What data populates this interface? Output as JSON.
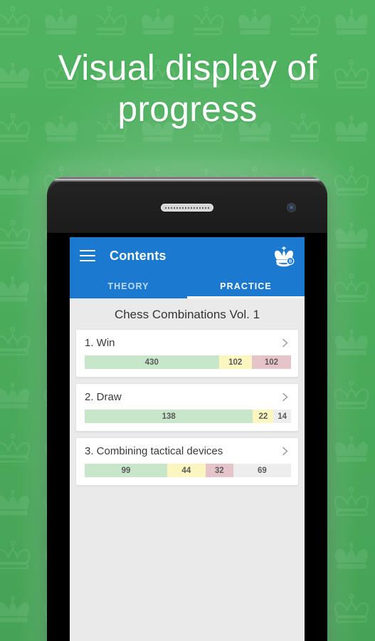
{
  "promo": {
    "headline_line1": "Visual display of",
    "headline_line2": "progress",
    "background_color": "#4bab5c",
    "pattern_icon": "chess-crown-pattern"
  },
  "device": {
    "speaker_icon": "speaker-grille",
    "camera_icon": "front-camera"
  },
  "app": {
    "bar": {
      "menu_icon": "hamburger-menu-icon",
      "title": "Contents",
      "logo_icon": "chess-king-crown-icon",
      "accent_color": "#1b79d0"
    },
    "tabs": [
      {
        "label": "THEORY",
        "active": false
      },
      {
        "label": "PRACTICE",
        "active": true
      }
    ],
    "book_title": "Chess Combinations Vol. 1",
    "chevron_icon": "chevron-right-icon",
    "legend_colors": {
      "solved": "#c8e6c9",
      "partial": "#fbf5c0",
      "failed": "#e5c5c9",
      "remaining": "#ededed"
    },
    "chapters": [
      {
        "label": "1. Win",
        "segments": [
          {
            "value": "430",
            "kind": "solved",
            "pct": 65.0
          },
          {
            "value": "102",
            "kind": "partial",
            "pct": 16.0
          },
          {
            "value": "102",
            "kind": "failed",
            "pct": 19.0
          }
        ]
      },
      {
        "label": "2. Draw",
        "segments": [
          {
            "value": "138",
            "kind": "solved",
            "pct": 81.5
          },
          {
            "value": "22",
            "kind": "partial",
            "pct": 10.0
          },
          {
            "value": "14",
            "kind": "rest",
            "pct": 8.5
          }
        ]
      },
      {
        "label": "3. Combining tactical devices",
        "segments": [
          {
            "value": "99",
            "kind": "solved",
            "pct": 40.0
          },
          {
            "value": "44",
            "kind": "partial",
            "pct": 18.5
          },
          {
            "value": "32",
            "kind": "failed",
            "pct": 13.5
          },
          {
            "value": "69",
            "kind": "rest",
            "pct": 28.0
          }
        ]
      }
    ]
  }
}
